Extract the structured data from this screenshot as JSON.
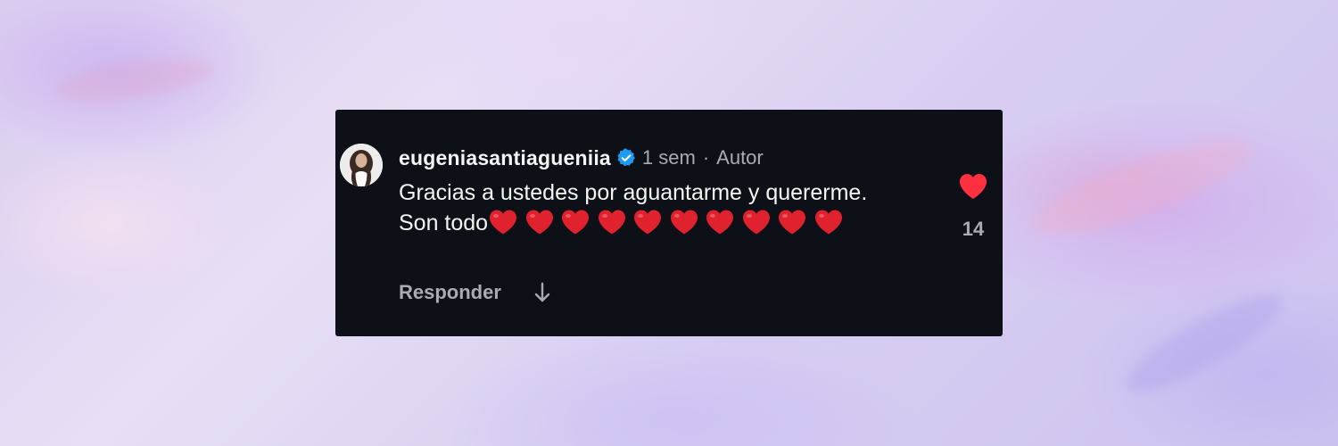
{
  "comment": {
    "username": "eugeniasantiagueniia",
    "verified_icon": "verified-badge-icon",
    "timestamp": "1 sem",
    "separator": "·",
    "role": "Autor",
    "text": "Gracias a ustedes por aguantarme y quererme. Son todo",
    "trailing_emoji": "❤️",
    "trailing_emoji_count": 10,
    "reply_label": "Responder",
    "expand_icon": "down-arrow-icon",
    "like_icon": "heart-filled-icon",
    "like_count": "14"
  },
  "colors": {
    "card_background": "#0d1016",
    "primary_text": "#f4f4f4",
    "secondary_text": "#a8acb3",
    "verified_blue": "#1d9bf0",
    "like_red": "#ff3040",
    "emoji_red": "#e0212e"
  }
}
